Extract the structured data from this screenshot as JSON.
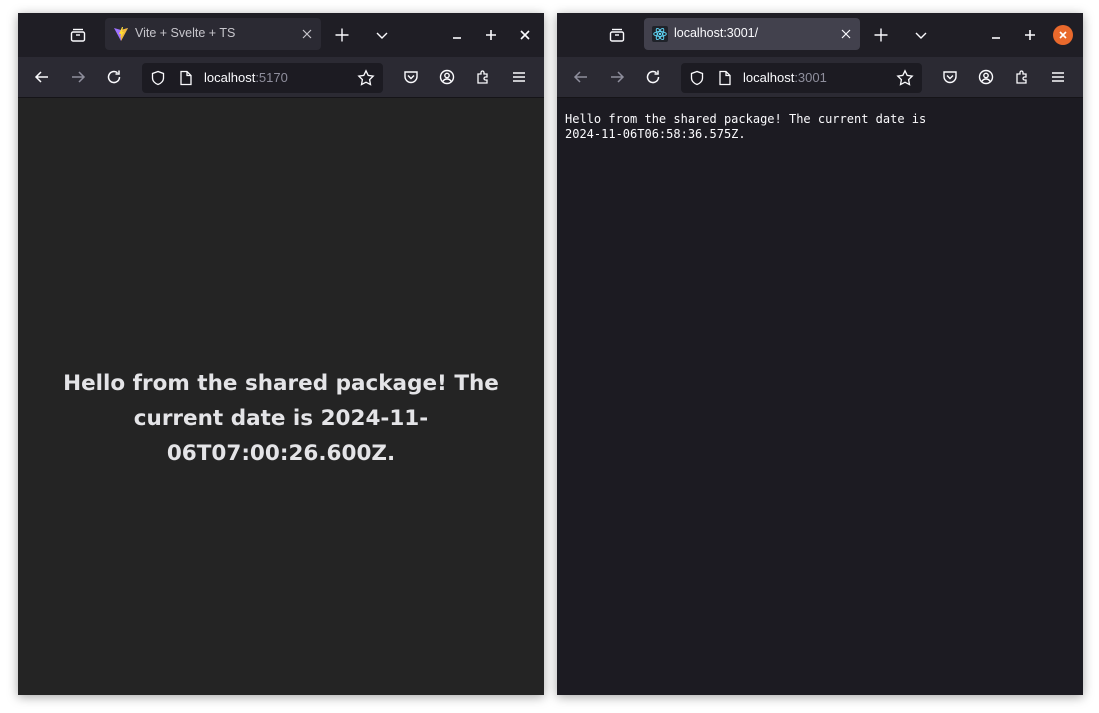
{
  "left_window": {
    "tab_title": "Vite + Svelte + TS",
    "url_host": "localhost",
    "url_port": ":5170",
    "message": "Hello from the shared package! The current date is 2024-11-06T07:00:26.600Z."
  },
  "right_window": {
    "tab_title": "localhost:3001/",
    "url_host": "localhost",
    "url_port": ":3001",
    "message": "Hello from the shared package! The current date is\n2024-11-06T06:58:36.575Z."
  },
  "colors": {
    "close_accent": "#e9692c",
    "chrome_dark": "#1f1e25",
    "toolbar": "#2b2a33"
  },
  "icons": [
    "collections-icon",
    "new-tab-icon",
    "tab-list-icon",
    "minimize-icon",
    "maximize-icon",
    "close-icon",
    "back-icon",
    "forward-icon",
    "reload-icon",
    "shield-icon",
    "page-icon",
    "star-icon",
    "pocket-icon",
    "account-icon",
    "extensions-icon",
    "menu-icon"
  ]
}
